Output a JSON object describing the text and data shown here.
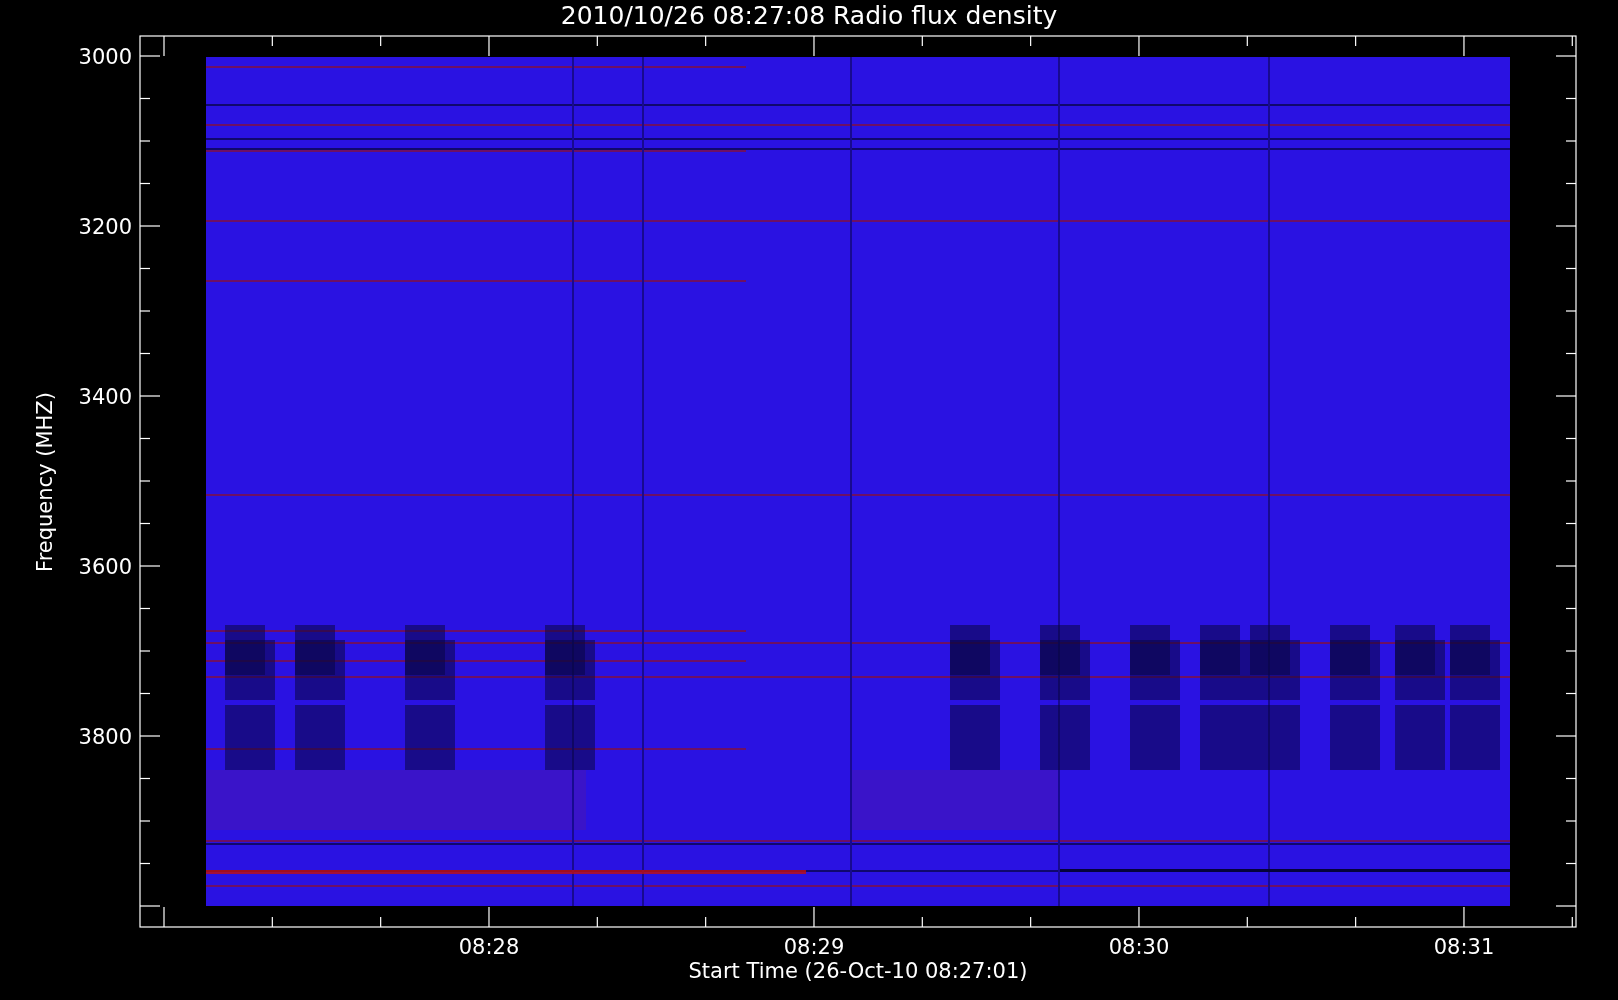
{
  "title": "2010/10/26 08:27:08 Radio flux density",
  "y_axis": {
    "label": "Frequency (MHZ)",
    "tick_labels": [
      "3000",
      "3200",
      "3400",
      "3600",
      "3800"
    ]
  },
  "x_axis": {
    "label": "Start Time (26-Oct-10 08:27:01)",
    "tick_labels": [
      "08:28",
      "08:29",
      "08:30",
      "08:31"
    ]
  }
}
